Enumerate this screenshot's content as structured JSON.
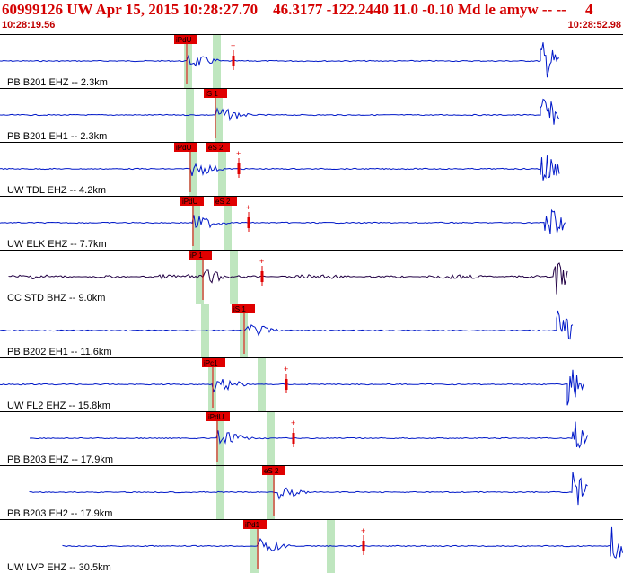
{
  "header": {
    "title": "60999126 UW Apr 15, 2015 10:28:27.70    46.3177 -122.2440 11.0 -0.10 Md le amyw -- --     4",
    "start_time": "10:28:19.56",
    "end_time": "10:28:52.98"
  },
  "colors": {
    "trace": "#0018c8",
    "trace_alt": "#220044",
    "pick": "#e00000",
    "window": "#bfe6bf",
    "header_text": "#d40000"
  },
  "traces": [
    {
      "label": "PB B201 EHZ -- 2.3km",
      "picks": [
        "iPdU"
      ],
      "alt_color": false
    },
    {
      "label": "PB B201 EH1 -- 2.3km",
      "picks": [
        "iS 1"
      ],
      "alt_color": false
    },
    {
      "label": "UW TDL EHZ -- 4.2km",
      "picks": [
        "iPdU",
        "eS 2"
      ],
      "alt_color": false
    },
    {
      "label": "UW ELK EHZ -- 7.7km",
      "picks": [
        "iPdU",
        "eS 2"
      ],
      "alt_color": false
    },
    {
      "label": "CC STD BHZ -- 9.0km",
      "picks": [
        "iP 1"
      ],
      "alt_color": true
    },
    {
      "label": "PB B202 EH1 -- 11.6km",
      "picks": [
        "iS 1"
      ],
      "alt_color": false
    },
    {
      "label": "UW FL2 EHZ -- 15.8km",
      "picks": [
        "iPc1"
      ],
      "alt_color": false
    },
    {
      "label": "PB B203 EHZ -- 17.9km",
      "picks": [
        "iPdU"
      ],
      "alt_color": false
    },
    {
      "label": "PB B203 EH2 -- 17.9km",
      "picks": [
        "eS 2"
      ],
      "alt_color": false
    },
    {
      "label": "UW LVP EHZ -- 30.5km",
      "picks": [
        "iPd1"
      ],
      "alt_color": false
    }
  ]
}
